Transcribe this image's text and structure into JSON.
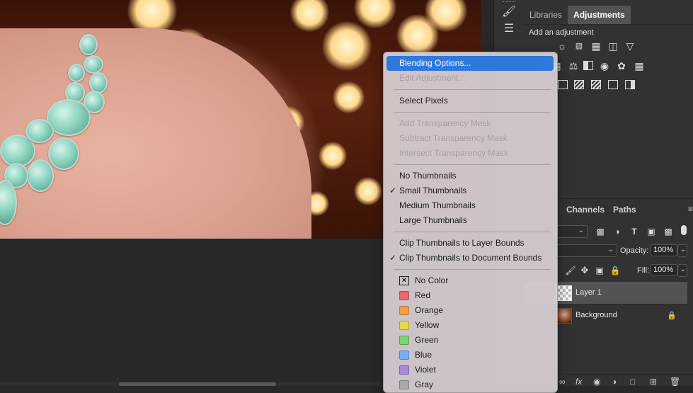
{
  "panels": {
    "tabs": [
      "Libraries",
      "Adjustments"
    ],
    "active_tab": "Adjustments",
    "adjustments_title": "Add an adjustment",
    "layers_tabs": [
      "Channels",
      "Paths"
    ],
    "opacity_label": "Opacity:",
    "opacity_value": "100%",
    "fill_label": "Fill:",
    "fill_value": "100%",
    "layers": [
      {
        "name": "Layer 1",
        "selected": true
      },
      {
        "name": "Background",
        "selected": false
      }
    ],
    "bottom_fx": "fx"
  },
  "context_menu": {
    "items": [
      {
        "label": "Blending Options...",
        "state": "highlighted"
      },
      {
        "label": "Edit Adjustment...",
        "state": "disabled"
      },
      {
        "label": "Select Pixels",
        "state": "normal"
      },
      {
        "label": "Add Transparency Mask",
        "state": "disabled"
      },
      {
        "label": "Subtract Transparency Mask",
        "state": "disabled"
      },
      {
        "label": "Intersect Transparency Mask",
        "state": "disabled"
      },
      {
        "label": "No Thumbnails",
        "state": "normal"
      },
      {
        "label": "Small Thumbnails",
        "state": "checked"
      },
      {
        "label": "Medium Thumbnails",
        "state": "normal"
      },
      {
        "label": "Large Thumbnails",
        "state": "normal"
      },
      {
        "label": "Clip Thumbnails to Layer Bounds",
        "state": "normal"
      },
      {
        "label": "Clip Thumbnails to Document Bounds",
        "state": "checked"
      }
    ],
    "colors": [
      {
        "label": "No Color",
        "color": "none"
      },
      {
        "label": "Red",
        "color": "#e8676a"
      },
      {
        "label": "Orange",
        "color": "#f0a04e"
      },
      {
        "label": "Yellow",
        "color": "#e6d94a"
      },
      {
        "label": "Green",
        "color": "#7ed46e"
      },
      {
        "label": "Blue",
        "color": "#78aef0"
      },
      {
        "label": "Violet",
        "color": "#a48ad8"
      },
      {
        "label": "Gray",
        "color": "#a9a9a9"
      }
    ]
  }
}
